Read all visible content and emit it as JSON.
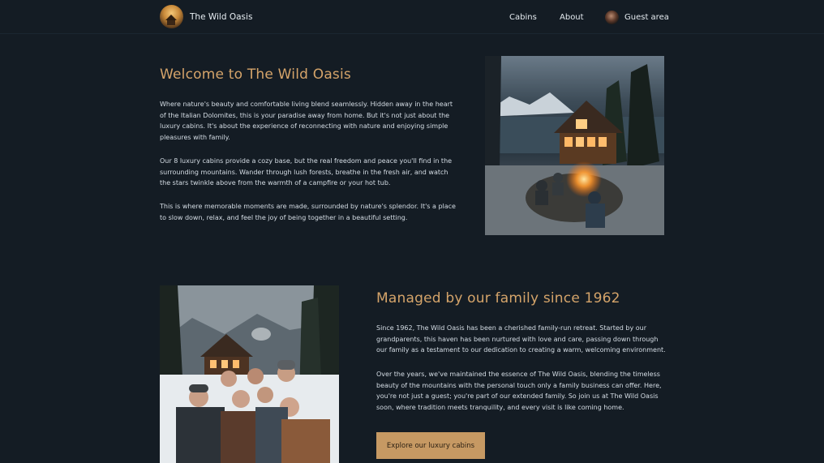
{
  "header": {
    "brand": "The Wild Oasis",
    "nav": {
      "cabins": "Cabins",
      "about": "About",
      "guest_area": "Guest area"
    }
  },
  "intro": {
    "title": "Welcome to The Wild Oasis",
    "p1": "Where nature's beauty and comfortable living blend seamlessly. Hidden away in the heart of the Italian Dolomites, this is your paradise away from home. But it's not just about the luxury cabins. It's about the experience of reconnecting with nature and enjoying simple pleasures with family.",
    "p2": "Our 8 luxury cabins provide a cozy base, but the real freedom and peace you'll find in the surrounding mountains. Wander through lush forests, breathe in the fresh air, and watch the stars twinkle above from the warmth of a campfire or your hot tub.",
    "p3": "This is where memorable moments are made, surrounded by nature's splendor. It's a place to slow down, relax, and feel the joy of being together in a beautiful setting."
  },
  "family": {
    "title": "Managed by our family since 1962",
    "p1": "Since 1962, The Wild Oasis has been a cherished family-run retreat. Started by our grandparents, this haven has been nurtured with love and care, passing down through our family as a testament to our dedication to creating a warm, welcoming environment.",
    "p2": "Over the years, we've maintained the essence of The Wild Oasis, blending the timeless beauty of the mountains with the personal touch only a family business can offer. Here, you're not just a guest; you're part of our extended family. So join us at The Wild Oasis soon, where tradition meets tranquility, and every visit is like coming home.",
    "cta": "Explore our luxury cabins"
  },
  "colors": {
    "background": "#141c24",
    "accent": "#d5a46a",
    "button": "#c69963"
  }
}
